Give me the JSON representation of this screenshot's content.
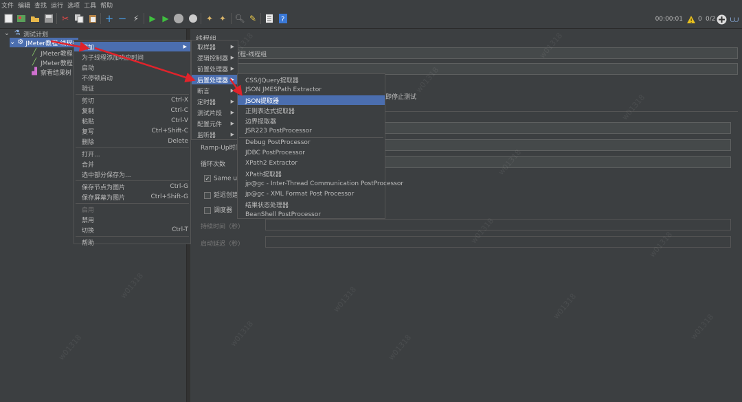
{
  "menubar": [
    "文件",
    "编辑",
    "查找",
    "运行",
    "选项",
    "工具",
    "帮助"
  ],
  "toolbar": {
    "timer": "00:00:01",
    "warn_count": "0",
    "threads": "0/2"
  },
  "tree": {
    "root": "测试计划",
    "thread_group": "JMeter教程-线程组",
    "sampler1": "JMeter教程",
    "sampler2": "JMeter教程",
    "listener": "察看结果树"
  },
  "right": {
    "panel_title": "线程组",
    "name_value": "教程-线程组",
    "stop_test_label": "即停止测试",
    "ramp_label": "Ramp-Up时间",
    "loop_label": "循环次数",
    "same_user_label": "Same use",
    "delay_label": "延迟创建",
    "scheduler_label": "调度器",
    "duration_label": "持续时间（秒）",
    "startup_delay_label": "启动延迟（秒）"
  },
  "context_menu": {
    "items": [
      {
        "label": "添加",
        "shortcut": "",
        "submenu": true,
        "active": true
      },
      {
        "label": "为子线程添加响应时间",
        "shortcut": "",
        "submenu": false
      },
      {
        "label": "启动",
        "shortcut": "",
        "submenu": false
      },
      {
        "label": "不停顿启动",
        "shortcut": "",
        "submenu": false
      },
      {
        "label": "验证",
        "shortcut": "",
        "submenu": false
      },
      {
        "label": "剪切",
        "shortcut": "Ctrl-X",
        "submenu": false
      },
      {
        "label": "复制",
        "shortcut": "Ctrl-C",
        "submenu": false
      },
      {
        "label": "粘贴",
        "shortcut": "Ctrl-V",
        "submenu": false
      },
      {
        "label": "复写",
        "shortcut": "Ctrl+Shift-C",
        "submenu": false
      },
      {
        "label": "删除",
        "shortcut": "Delete",
        "submenu": false
      },
      {
        "label": "打开...",
        "shortcut": "",
        "submenu": false
      },
      {
        "label": "合并",
        "shortcut": "",
        "submenu": false
      },
      {
        "label": "选中部分保存为...",
        "shortcut": "",
        "submenu": false
      },
      {
        "label": "保存节点为图片",
        "shortcut": "Ctrl-G",
        "submenu": false
      },
      {
        "label": "保存屏幕为图片",
        "shortcut": "Ctrl+Shift-G",
        "submenu": false
      },
      {
        "label": "启用",
        "shortcut": "",
        "submenu": false,
        "disabled": true
      },
      {
        "label": "禁用",
        "shortcut": "",
        "submenu": false
      },
      {
        "label": "切换",
        "shortcut": "Ctrl-T",
        "submenu": false
      },
      {
        "label": "帮助",
        "shortcut": "",
        "submenu": false
      }
    ]
  },
  "add_submenu": {
    "items": [
      "取样器",
      "逻辑控制器",
      "前置处理器",
      "后置处理器",
      "断言",
      "定时器",
      "测试片段",
      "配置元件",
      "监听器"
    ]
  },
  "post_processor_submenu": {
    "items": [
      "CSS/JQuery提取器",
      "JSON JMESPath Extractor",
      "JSON提取器",
      "正则表达式提取器",
      "边界提取器",
      "JSR223 PostProcessor",
      "Debug PostProcessor",
      "JDBC PostProcessor",
      "XPath2 Extractor",
      "XPath提取器",
      "jp@gc - Inter-Thread Communication PostProcessor",
      "jp@gc - XML Format Post Processor",
      "结果状态处理器",
      "BeanShell PostProcessor"
    ]
  },
  "colors": {
    "bg": "#3c3f41",
    "selection": "#4b6eaf",
    "arrow": "#e0232b"
  },
  "watermark": "w01318"
}
